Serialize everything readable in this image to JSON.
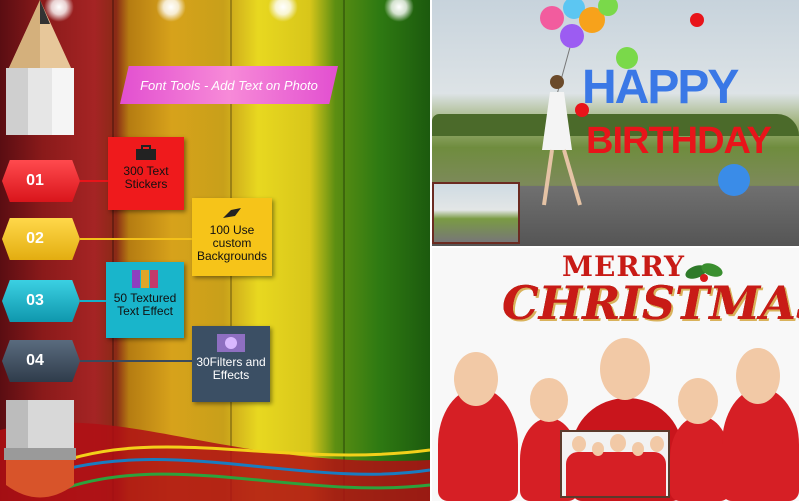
{
  "banner": {
    "title": "Font Tools - Add Text on Photo"
  },
  "steps": [
    {
      "num": "01",
      "color": "#e8141a",
      "text": "300 Text Stickers",
      "card_color": "#ef1a1c",
      "icon": "briefcase-icon"
    },
    {
      "num": "02",
      "color": "#f3c11a",
      "text": "100 Use custom Backgrounds",
      "card_color": "#f6c419",
      "icon": "brush-icon"
    },
    {
      "num": "03",
      "color": "#16b1c9",
      "text": "50 Textured Text Effect",
      "card_color": "#19b5cb",
      "icon": "texture-icon"
    },
    {
      "num": "04",
      "color": "#3a4a5c",
      "text": "30Filters and Effects",
      "card_color": "#3b4f64",
      "icon": "filter-icon"
    }
  ],
  "birthday": {
    "line1": "HAPPY",
    "line2": "BIRTHDAY"
  },
  "christmas": {
    "line1": "MERRY",
    "line2": "CHRISTMAS"
  },
  "colors": {
    "banner": "#e84fcf",
    "christmas_red": "#c81b16"
  }
}
